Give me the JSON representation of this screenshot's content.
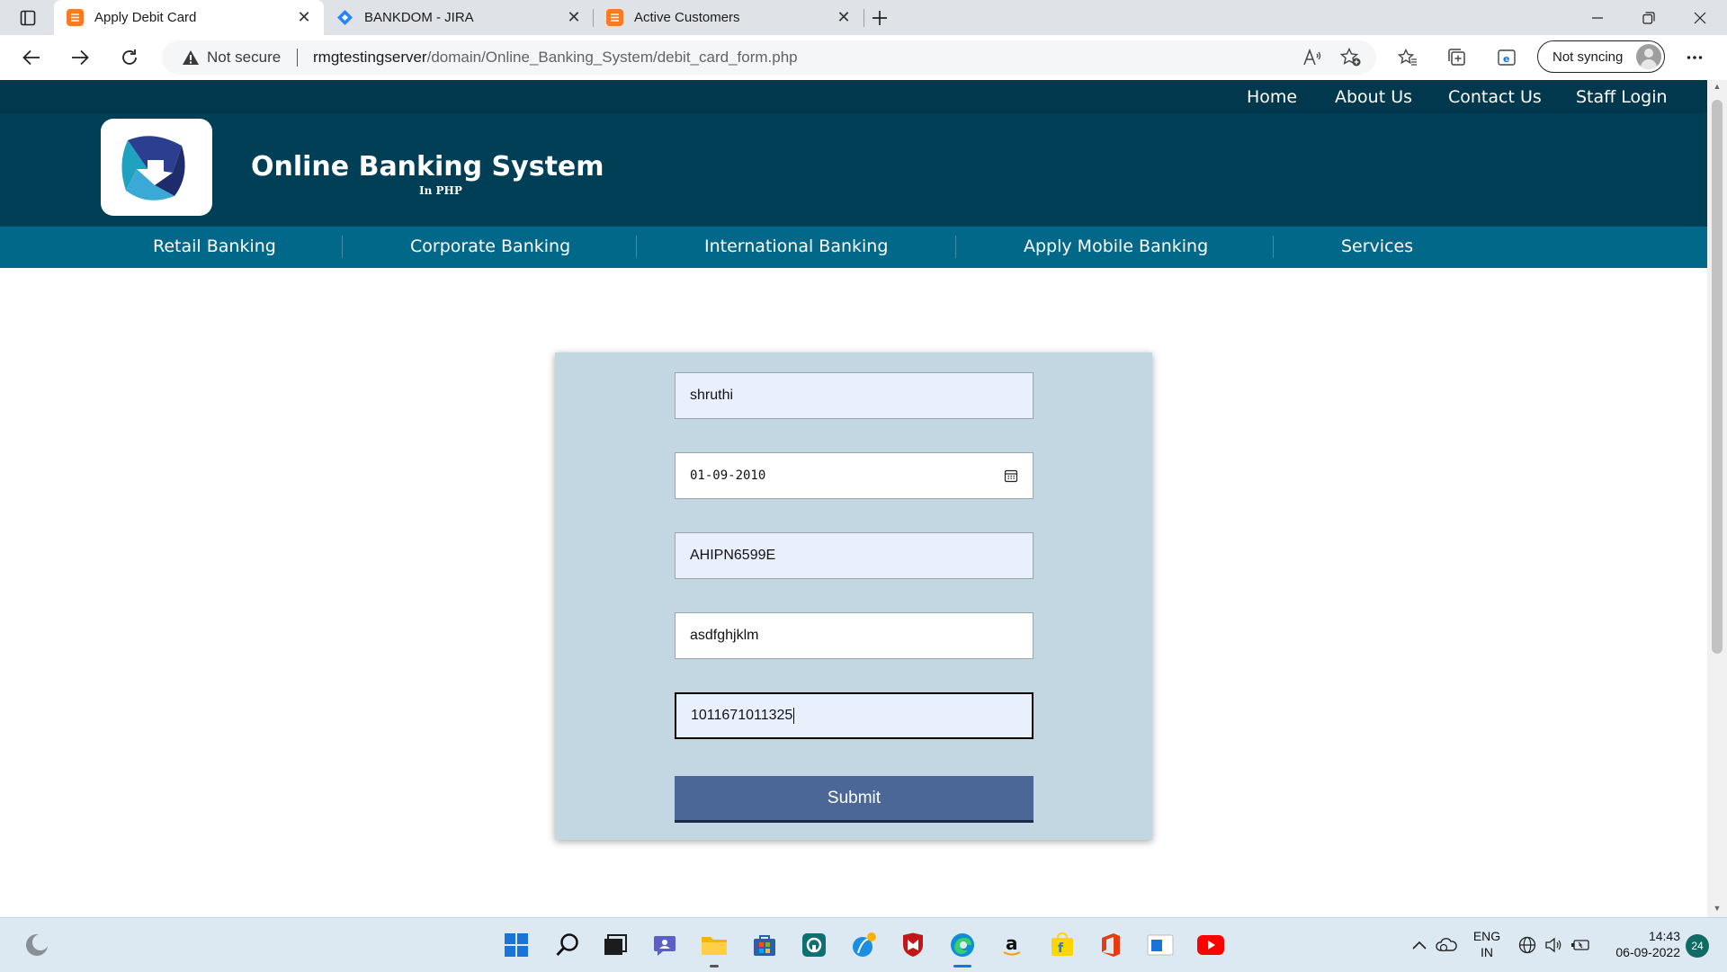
{
  "browser": {
    "tabs": [
      {
        "title": "Apply Debit Card",
        "active": true,
        "favicon": "xampp-icon"
      },
      {
        "title": "BANKDOM - JIRA",
        "active": false,
        "favicon": "jira-icon"
      },
      {
        "title": "Active Customers",
        "active": false,
        "favicon": "xampp-icon"
      }
    ],
    "address": {
      "security": "Not secure",
      "host": "rmgtestingserver",
      "path": "/domain/Online_Banking_System/debit_card_form.php"
    },
    "profile": {
      "label": "Not syncing"
    }
  },
  "site": {
    "top_nav": [
      "Home",
      "About Us",
      "Contact Us",
      "Staff Login"
    ],
    "title": "Online Banking System",
    "subtitle": "In PHP",
    "main_nav": [
      "Retail Banking",
      "Corporate Banking",
      "International Banking",
      "Apply Mobile Banking",
      "Services"
    ]
  },
  "form": {
    "fields": [
      {
        "value": "shruthi"
      },
      {
        "value": "01-09-2010"
      },
      {
        "value": "AHIPN6599E"
      },
      {
        "value": "asdfghjklm"
      },
      {
        "value": "1011671011325"
      }
    ],
    "submit_label": "Submit"
  },
  "taskbar": {
    "lang_top": "ENG",
    "lang_bottom": "IN",
    "time": "14:43",
    "date": "06-09-2022",
    "notification_count": "24"
  },
  "colors": {
    "topnav": "#01384d",
    "header": "#013f56",
    "mainnav": "#016889",
    "card": "#c2d7e1",
    "submit": "#4b6797"
  }
}
